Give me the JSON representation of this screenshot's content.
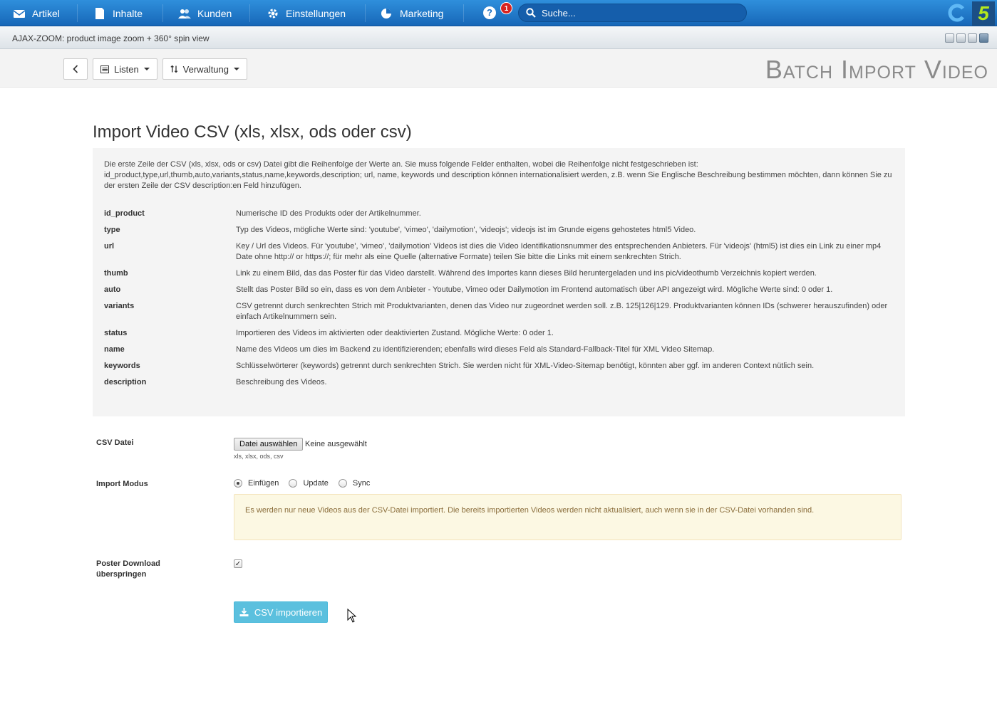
{
  "nav": {
    "items": [
      {
        "label": "Artikel",
        "icon": "envelope-icon"
      },
      {
        "label": "Inhalte",
        "icon": "document-icon"
      },
      {
        "label": "Kunden",
        "icon": "users-icon"
      },
      {
        "label": "Einstellungen",
        "icon": "gear-icon"
      },
      {
        "label": "Marketing",
        "icon": "pie-chart-icon"
      }
    ],
    "help": "?",
    "badge_count": "1",
    "search_placeholder": "Suche..."
  },
  "logo": {
    "mark": "5"
  },
  "window": {
    "title": "AJAX-ZOOM: product image zoom + 360° spin view"
  },
  "toolbar": {
    "lists_label": "Listen",
    "admin_label": "Verwaltung",
    "page_heading": "Batch Import Video"
  },
  "main": {
    "title": "Import Video CSV (xls, xlsx, ods oder csv)",
    "intro": "Die erste Zeile der CSV (xls, xlsx, ods or csv) Datei gibt die Reihenfolge der Werte an. Sie muss folgende Felder enthalten, wobei die Reihenfolge nicht festgeschrieben ist: id_product,type,url,thumb,auto,variants,status,name,keywords,description; url, name, keywords und description können internationalisiert werden, z.B. wenn Sie Englische Beschreibung bestimmen möchten, dann können Sie zu der ersten Zeile der CSV description:en Feld hinzufügen.",
    "fields": [
      {
        "name": "id_product",
        "desc": "Numerische ID des Produkts oder der Artikelnummer."
      },
      {
        "name": "type",
        "desc": "Typ des Videos, mögliche Werte sind: 'youtube', 'vimeo', 'dailymotion', 'videojs'; videojs ist im Grunde eigens gehostetes html5 Video."
      },
      {
        "name": "url",
        "desc": "Key / Url des Videos. Für 'youtube', 'vimeo', 'dailymotion' Videos ist dies die Video Identifikationsnummer des entsprechenden Anbieters. Für 'videojs' (html5) ist dies ein Link zu einer mp4 Date ohne http:// or https://; für mehr als eine Quelle (alternative Formate) teilen Sie bitte die Links mit einem senkrechten Strich."
      },
      {
        "name": "thumb",
        "desc": "Link zu einem Bild, das das Poster für das Video darstellt. Während des Importes kann dieses Bild heruntergeladen und ins pic/videothumb Verzeichnis kopiert werden."
      },
      {
        "name": "auto",
        "desc": "Stellt das Poster Bild so ein, dass es von dem Anbieter - Youtube, Vimeo oder Dailymotion im Frontend automatisch über API angezeigt wird. Mögliche Werte sind: 0 oder 1."
      },
      {
        "name": "variants",
        "desc": "CSV getrennt durch senkrechten Strich mit Produktvarianten, denen das Video nur zugeordnet werden soll. z.B. 125|126|129. Produktvarianten können IDs (schwerer herauszufinden) oder einfach Artikelnummern sein."
      },
      {
        "name": "status",
        "desc": "Importieren des Videos im aktivierten oder deaktivierten Zustand. Mögliche Werte: 0 oder 1."
      },
      {
        "name": "name",
        "desc": "Name des Videos um dies im Backend zu identifizierenden; ebenfalls wird dieses Feld als Standard-Fallback-Titel für XML Video Sitemap."
      },
      {
        "name": "keywords",
        "desc": "Schlüsselwörterer (keywords) getrennt durch senkrechten Strich. Sie werden nicht für XML-Video-Sitemap benötigt, könnten aber ggf. im anderen Context nütlich sein."
      },
      {
        "name": "description",
        "desc": "Beschreibung des Videos."
      }
    ]
  },
  "form": {
    "csv_label": "CSV Datei",
    "file_button": "Datei auswählen",
    "file_none": "Keine ausgewählt",
    "file_hint": "xls, xlsx, ods, csv",
    "mode_label": "Import Modus",
    "modes": [
      "Einfügen",
      "Update",
      "Sync"
    ],
    "mode_selected": "Einfügen",
    "mode_info": "Es werden nur neue Videos aus der CSV-Datei importiert. Die bereits importierten Videos werden nicht aktualisiert, auch wenn sie in der CSV-Datei vorhanden sind.",
    "poster_label_1": "Poster Download",
    "poster_label_2": "überspringen",
    "poster_checked": true,
    "import_button": "CSV importieren"
  }
}
